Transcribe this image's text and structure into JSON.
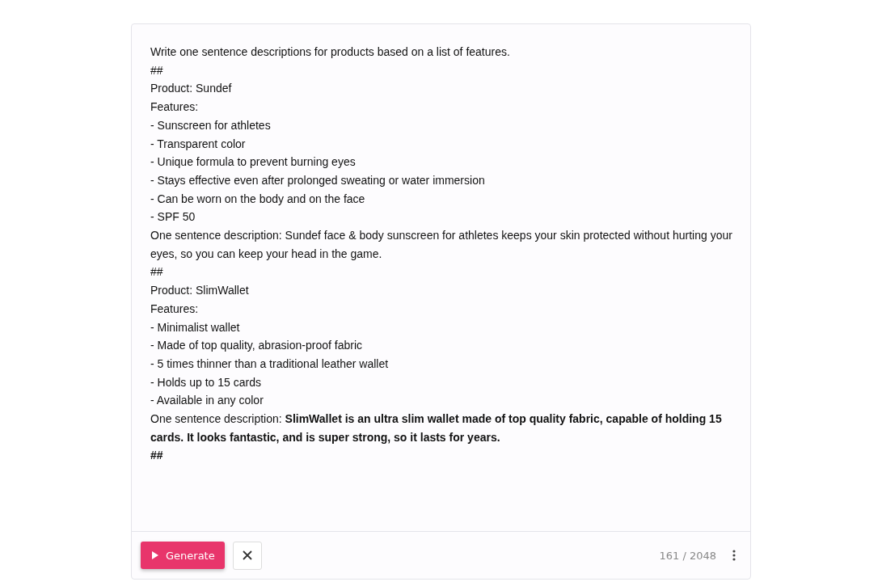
{
  "prompt": {
    "lines": [
      "Write one sentence descriptions for products based on a list of features.",
      "##",
      "Product: Sundef",
      "Features:",
      "- Sunscreen for athletes",
      "- Transparent color",
      "- Unique formula to prevent burning eyes",
      "- Stays effective even after prolonged sweating or water immersion",
      "- Can be worn on the body and on the face",
      "- SPF 50",
      "One sentence description: Sundef face & body sunscreen for athletes keeps your skin protected without hurting your eyes, so you can keep your head in the game.",
      "##",
      "Product: SlimWallet",
      "Features:",
      "- Minimalist wallet",
      "- Made of top quality, abrasion-proof fabric",
      "- 5 times thinner than a traditional leather wallet",
      "- Holds up to 15 cards",
      "- Available in any color",
      "One sentence description: **SlimWallet is an ultra slim wallet made of top quality fabric, capable of holding 15 cards. It looks fantastic, and is super strong, so it lasts for years.**",
      "**##**"
    ]
  },
  "footer": {
    "generate_label": "Generate",
    "token_count": "161 / 2048"
  }
}
